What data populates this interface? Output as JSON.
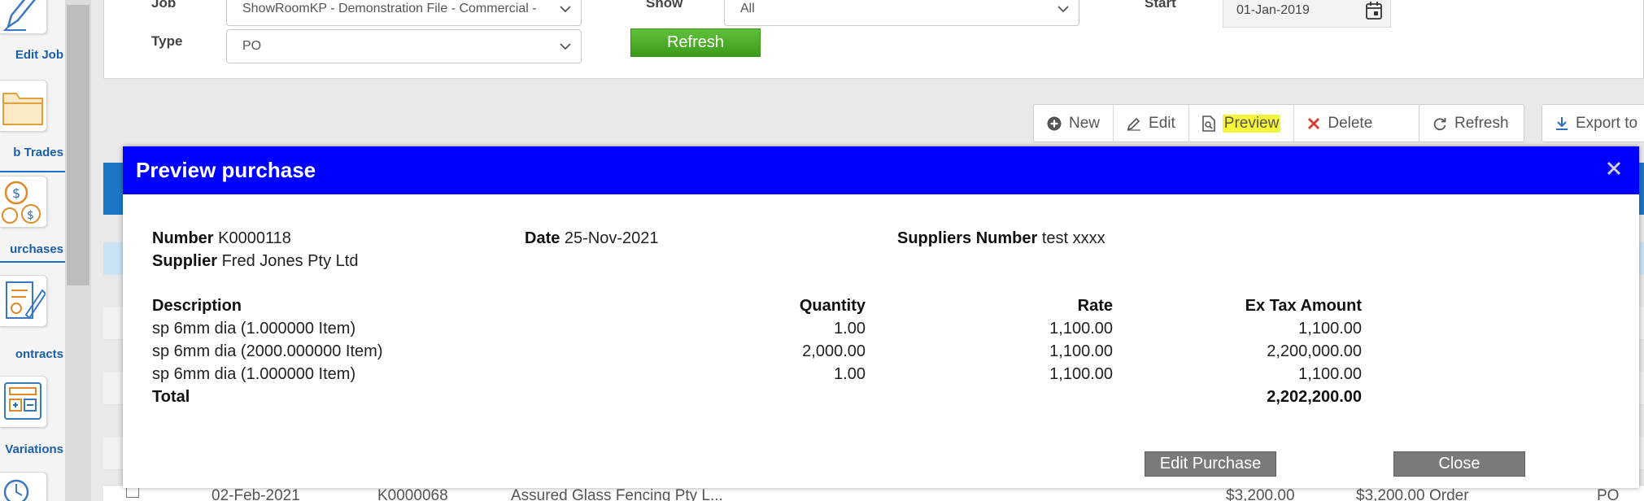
{
  "nav": {
    "items": [
      {
        "label": "Edit Job",
        "icon": "pencil-icon"
      },
      {
        "label": "b Trades",
        "icon": "folder-icon"
      },
      {
        "label": "urchases",
        "icon": "coins-icon"
      },
      {
        "label": "ontracts",
        "icon": "contract-icon"
      },
      {
        "label": "Variations",
        "icon": "calculator-icon"
      }
    ]
  },
  "filters": {
    "job_label": "Job",
    "job_value": "ShowRoomKP - Demonstration File - Commercial -",
    "type_label": "Type",
    "type_value": "PO",
    "show_label": "Show",
    "show_value": "All",
    "start_label": "Start",
    "start_value": "01-Jan-2019",
    "refresh_label": "Refresh"
  },
  "toolbar": {
    "new": "New",
    "edit": "Edit",
    "preview": "Preview",
    "delete": "Delete",
    "refresh": "Refresh",
    "export": "Export to"
  },
  "background_row": {
    "date": "02-Feb-2021",
    "number": "K0000068",
    "supplier": "Assured Glass Fencing Pty L...",
    "amount1": "$3,200.00",
    "amount2": "$3,200.00",
    "status": "Order",
    "type": "PO"
  },
  "modal": {
    "title": "Preview purchase",
    "number_label": "Number",
    "number_value": "K0000118",
    "supplier_label": "Supplier",
    "supplier_value": "Fred Jones Pty Ltd",
    "date_label": "Date",
    "date_value": "25-Nov-2021",
    "suppliers_number_label": "Suppliers Number",
    "suppliers_number_value": "test xxxx",
    "columns": {
      "description": "Description",
      "quantity": "Quantity",
      "rate": "Rate",
      "amount": "Ex Tax Amount"
    },
    "lines": [
      {
        "description": "sp 6mm dia (1.000000 Item)",
        "quantity": "1.00",
        "rate": "1,100.00",
        "amount": "1,100.00"
      },
      {
        "description": "sp 6mm dia (2000.000000 Item)",
        "quantity": "2,000.00",
        "rate": "1,100.00",
        "amount": "2,200,000.00"
      },
      {
        "description": "sp 6mm dia (1.000000 Item)",
        "quantity": "1.00",
        "rate": "1,100.00",
        "amount": "1,100.00"
      }
    ],
    "total_label": "Total",
    "total_value": "2,202,200.00",
    "edit_button": "Edit Purchase",
    "close_button": "Close"
  }
}
